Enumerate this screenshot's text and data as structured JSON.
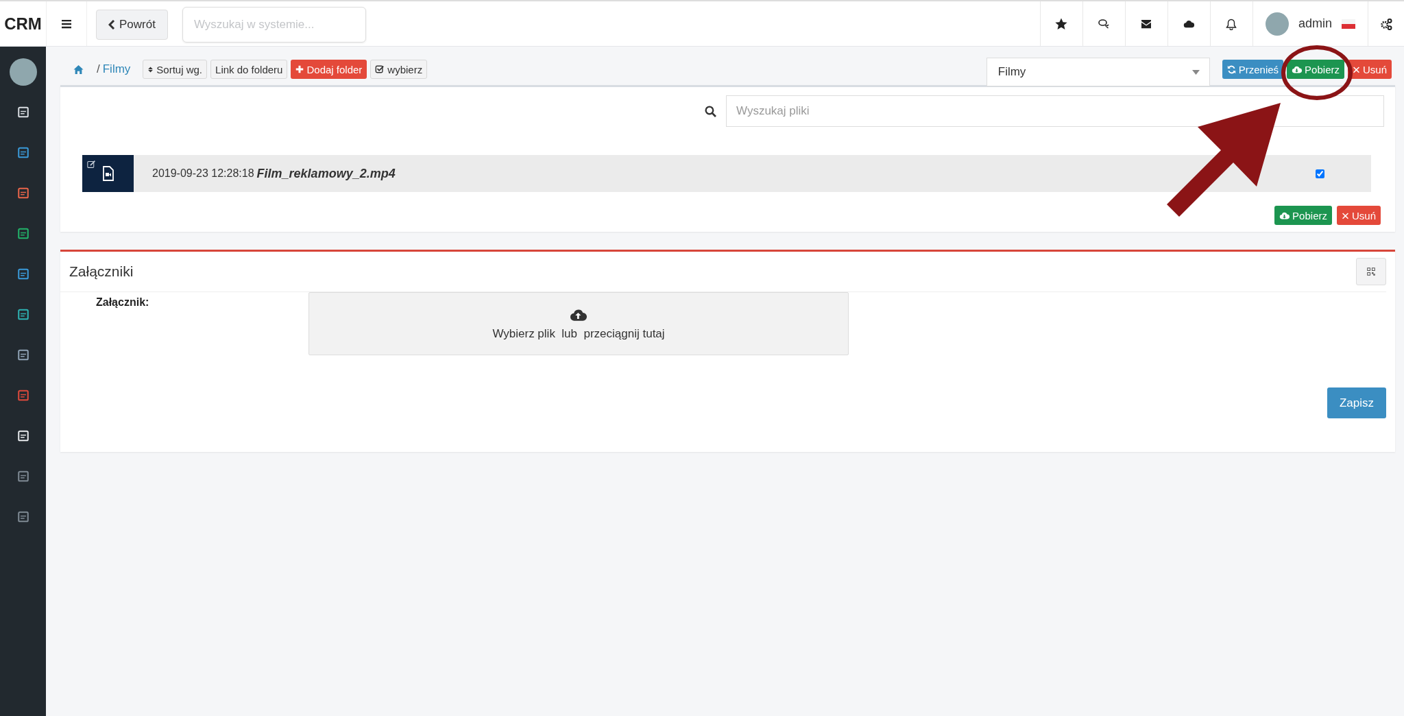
{
  "topbar": {
    "logo": "CRM",
    "back_button": "Powrót",
    "search": {
      "placeholder": "Wyszukaj w systemie..."
    },
    "user": {
      "name": "admin"
    }
  },
  "breadcrumb": {
    "separator": "/",
    "current": "Filmy"
  },
  "toolbar": [
    {
      "kind": "sort",
      "label": "Sortuj wg."
    },
    {
      "kind": "plain",
      "label": "Link do folderu"
    },
    {
      "kind": "add",
      "label": "Dodaj folder"
    },
    {
      "kind": "select",
      "label": "wybierz"
    }
  ],
  "folder_select": {
    "value": "Filmy"
  },
  "actions": [
    {
      "kind": "move",
      "label": "Przenieś"
    },
    {
      "kind": "download",
      "label": "Pobierz"
    },
    {
      "kind": "delete",
      "label": "Usuń"
    }
  ],
  "file_search": {
    "placeholder": "Wyszukaj pliki"
  },
  "files": [
    {
      "date": "2019-09-23 12:28:18",
      "name": "Film_reklamowy_2.mp4",
      "checked": true
    }
  ],
  "file_actions": [
    {
      "kind": "download",
      "label": "Pobierz"
    },
    {
      "kind": "delete",
      "label": "Usuń"
    }
  ],
  "attachments": {
    "title": "Załączniki",
    "label": "Załącznik:",
    "dropzone_text": "Wybierz plik  lub  przeciągnij tutaj",
    "save_button": "Zapisz"
  }
}
